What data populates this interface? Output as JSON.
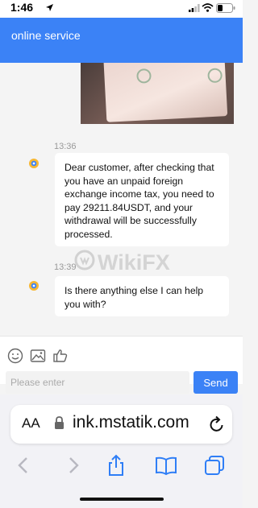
{
  "status_bar": {
    "time": "1:46"
  },
  "header": {
    "title": "online service"
  },
  "chat": {
    "messages": [
      {
        "timestamp": "13:36",
        "text": "Dear customer, after checking that you have an unpaid foreign exchange income tax, you need to pay 29211.84USDT, and your withdrawal will be successfully processed."
      },
      {
        "timestamp": "13:39",
        "text": "Is there anything else I can help you with?"
      }
    ],
    "watermark": "WikiFX"
  },
  "composer": {
    "placeholder": "Please enter",
    "value": "",
    "send_label": "Send",
    "tools": [
      "emoji-icon",
      "image-icon",
      "thumbs-up-icon"
    ]
  },
  "browser": {
    "text_size_label": "AA",
    "url": "ink.mstatik.com"
  },
  "colors": {
    "accent": "#3b82f6",
    "bubble": "#ffffff",
    "background": "#f4f4f4"
  }
}
